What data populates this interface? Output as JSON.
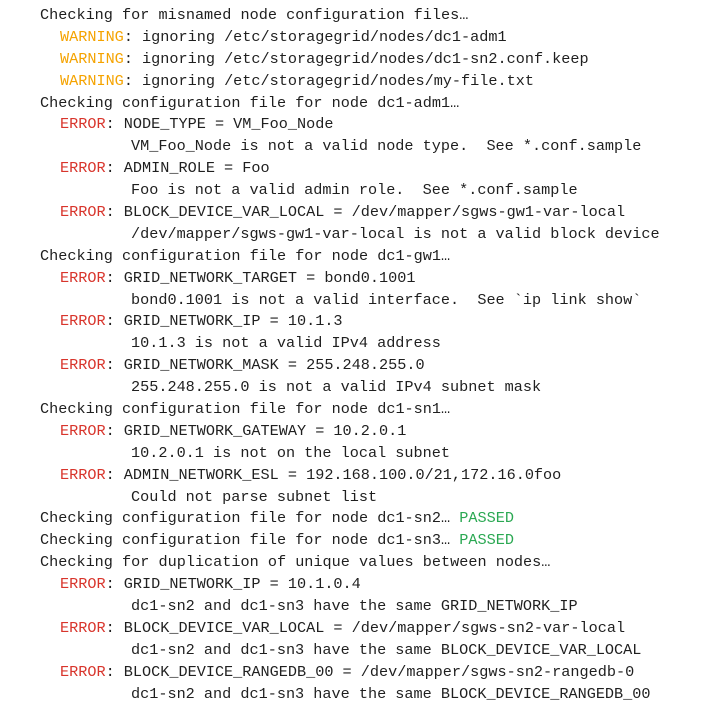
{
  "colors": {
    "warning": "#f5a300",
    "error": "#d8352c",
    "passed": "#2aa852",
    "text": "#1f1f1f"
  },
  "lines": [
    {
      "indent": 0,
      "text": "Checking for misnamed node configuration files…"
    },
    {
      "indent": 1,
      "tag": "WARNING",
      "text": ": ignoring /etc/storagegrid/nodes/dc1-adm1"
    },
    {
      "indent": 1,
      "tag": "WARNING",
      "text": ": ignoring /etc/storagegrid/nodes/dc1-sn2.conf.keep"
    },
    {
      "indent": 1,
      "tag": "WARNING",
      "text": ": ignoring /etc/storagegrid/nodes/my-file.txt"
    },
    {
      "indent": 0,
      "text": "Checking configuration file for node dc1-adm1…"
    },
    {
      "indent": 1,
      "tag": "ERROR",
      "text": ": NODE_TYPE = VM_Foo_Node"
    },
    {
      "indent": 2,
      "text": "VM_Foo_Node is not a valid node type.  See *.conf.sample"
    },
    {
      "indent": 1,
      "tag": "ERROR",
      "text": ": ADMIN_ROLE = Foo"
    },
    {
      "indent": 2,
      "text": "Foo is not a valid admin role.  See *.conf.sample"
    },
    {
      "indent": 1,
      "tag": "ERROR",
      "text": ": BLOCK_DEVICE_VAR_LOCAL = /dev/mapper/sgws-gw1-var-local"
    },
    {
      "indent": 2,
      "text": "/dev/mapper/sgws-gw1-var-local is not a valid block device"
    },
    {
      "indent": 0,
      "text": "Checking configuration file for node dc1-gw1…"
    },
    {
      "indent": 1,
      "tag": "ERROR",
      "text": ": GRID_NETWORK_TARGET = bond0.1001"
    },
    {
      "indent": 2,
      "text": "bond0.1001 is not a valid interface.  See `ip link show`"
    },
    {
      "indent": 1,
      "tag": "ERROR",
      "text": ": GRID_NETWORK_IP = 10.1.3"
    },
    {
      "indent": 2,
      "text": "10.1.3 is not a valid IPv4 address"
    },
    {
      "indent": 1,
      "tag": "ERROR",
      "text": ": GRID_NETWORK_MASK = 255.248.255.0"
    },
    {
      "indent": 2,
      "text": "255.248.255.0 is not a valid IPv4 subnet mask"
    },
    {
      "indent": 0,
      "text": "Checking configuration file for node dc1-sn1…"
    },
    {
      "indent": 1,
      "tag": "ERROR",
      "text": ": GRID_NETWORK_GATEWAY = 10.2.0.1"
    },
    {
      "indent": 2,
      "text": "10.2.0.1 is not on the local subnet"
    },
    {
      "indent": 1,
      "tag": "ERROR",
      "text": ": ADMIN_NETWORK_ESL = 192.168.100.0/21,172.16.0foo"
    },
    {
      "indent": 2,
      "text": "Could not parse subnet list"
    },
    {
      "indent": 0,
      "text": "Checking configuration file for node dc1-sn2… ",
      "suffix": "PASSED"
    },
    {
      "indent": 0,
      "text": "Checking configuration file for node dc1-sn3… ",
      "suffix": "PASSED"
    },
    {
      "indent": 0,
      "text": "Checking for duplication of unique values between nodes…"
    },
    {
      "indent": 1,
      "tag": "ERROR",
      "text": ": GRID_NETWORK_IP = 10.1.0.4"
    },
    {
      "indent": 2,
      "text": "dc1-sn2 and dc1-sn3 have the same GRID_NETWORK_IP"
    },
    {
      "indent": 1,
      "tag": "ERROR",
      "text": ": BLOCK_DEVICE_VAR_LOCAL = /dev/mapper/sgws-sn2-var-local"
    },
    {
      "indent": 2,
      "text": "dc1-sn2 and dc1-sn3 have the same BLOCK_DEVICE_VAR_LOCAL"
    },
    {
      "indent": 1,
      "tag": "ERROR",
      "text": ": BLOCK_DEVICE_RANGEDB_00 = /dev/mapper/sgws-sn2-rangedb-0"
    },
    {
      "indent": 2,
      "text": "dc1-sn2 and dc1-sn3 have the same BLOCK_DEVICE_RANGEDB_00"
    }
  ]
}
